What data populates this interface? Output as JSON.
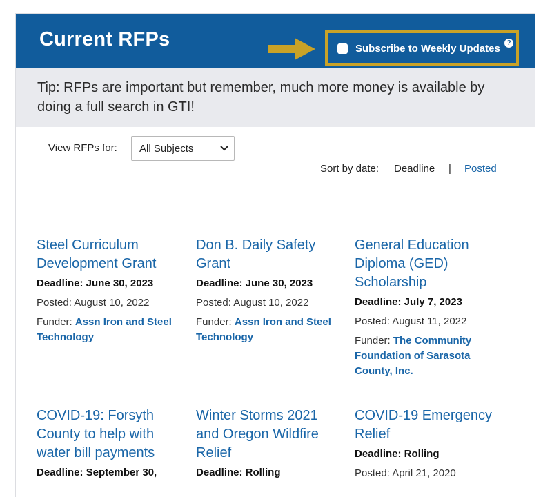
{
  "header": {
    "title": "Current RFPs",
    "subscribe_label": "Subscribe to Weekly Updates",
    "help_glyph": "?"
  },
  "tip": "Tip: RFPs are important but remember, much more money is available by doing a full search in GTI!",
  "filters": {
    "view_label": "View RFPs for:",
    "subject_selected": "All Subjects",
    "sort_label": "Sort by date:",
    "sort_deadline": "Deadline",
    "sort_separator": "|",
    "sort_posted": "Posted"
  },
  "cards": [
    {
      "title": "Steel Curriculum Development Grant",
      "deadline": "Deadline: June 30, 2023",
      "posted": "Posted: August 10, 2022",
      "funder_label": "Funder: ",
      "funder": "Assn Iron and Steel Technology"
    },
    {
      "title": "Don B. Daily Safety Grant",
      "deadline": "Deadline: June 30, 2023",
      "posted": "Posted: August 10, 2022",
      "funder_label": "Funder: ",
      "funder": "Assn Iron and Steel Technology"
    },
    {
      "title": "General Education Diploma (GED) Scholarship",
      "deadline": "Deadline: July 7, 2023",
      "posted": "Posted: August 11, 2022",
      "funder_label": "Funder: ",
      "funder": "The Community Foundation of Sarasota County, Inc."
    },
    {
      "title": "COVID-19: Forsyth County to help with water bill payments",
      "deadline": "Deadline: September 30,"
    },
    {
      "title": "Winter Storms 2021 and Oregon Wildfire Relief",
      "deadline": "Deadline: Rolling"
    },
    {
      "title": "COVID-19 Emergency Relief",
      "deadline": "Deadline: Rolling",
      "posted": "Posted: April 21, 2020"
    }
  ],
  "colors": {
    "header_bg": "#115c9c",
    "highlight": "#c9a227",
    "link": "#1a66a8",
    "tip_bg": "#e9eaee"
  }
}
